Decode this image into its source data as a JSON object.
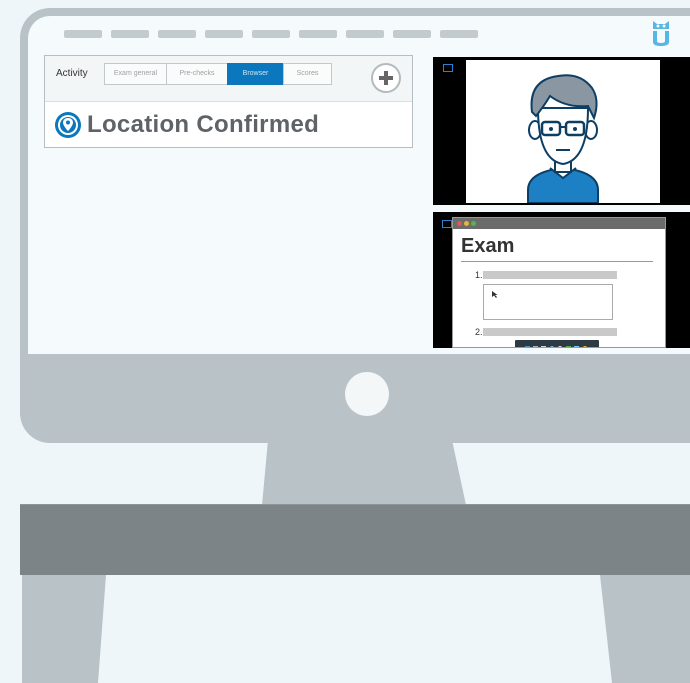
{
  "activity_panel": {
    "label": "Activity",
    "tabs": [
      {
        "label": "Exam general",
        "active": false
      },
      {
        "label": "Pre-checks",
        "active": false
      },
      {
        "label": "Browser",
        "active": true
      },
      {
        "label": "Scores",
        "active": false
      }
    ],
    "location_status": "Location Confirmed"
  },
  "exam_screen": {
    "title": "Exam",
    "questions": [
      {
        "number": "1."
      },
      {
        "number": "2."
      }
    ]
  },
  "colors": {
    "accent": "#0b77bd",
    "monitor": "#b9c3c7",
    "desk": "#7c8487",
    "avatar_shirt": "#1d7fc4",
    "background": "#eef6fa"
  },
  "icons": [
    "location-pin-icon",
    "plus-icon",
    "owl-logo-icon",
    "camera-corner-icon"
  ]
}
